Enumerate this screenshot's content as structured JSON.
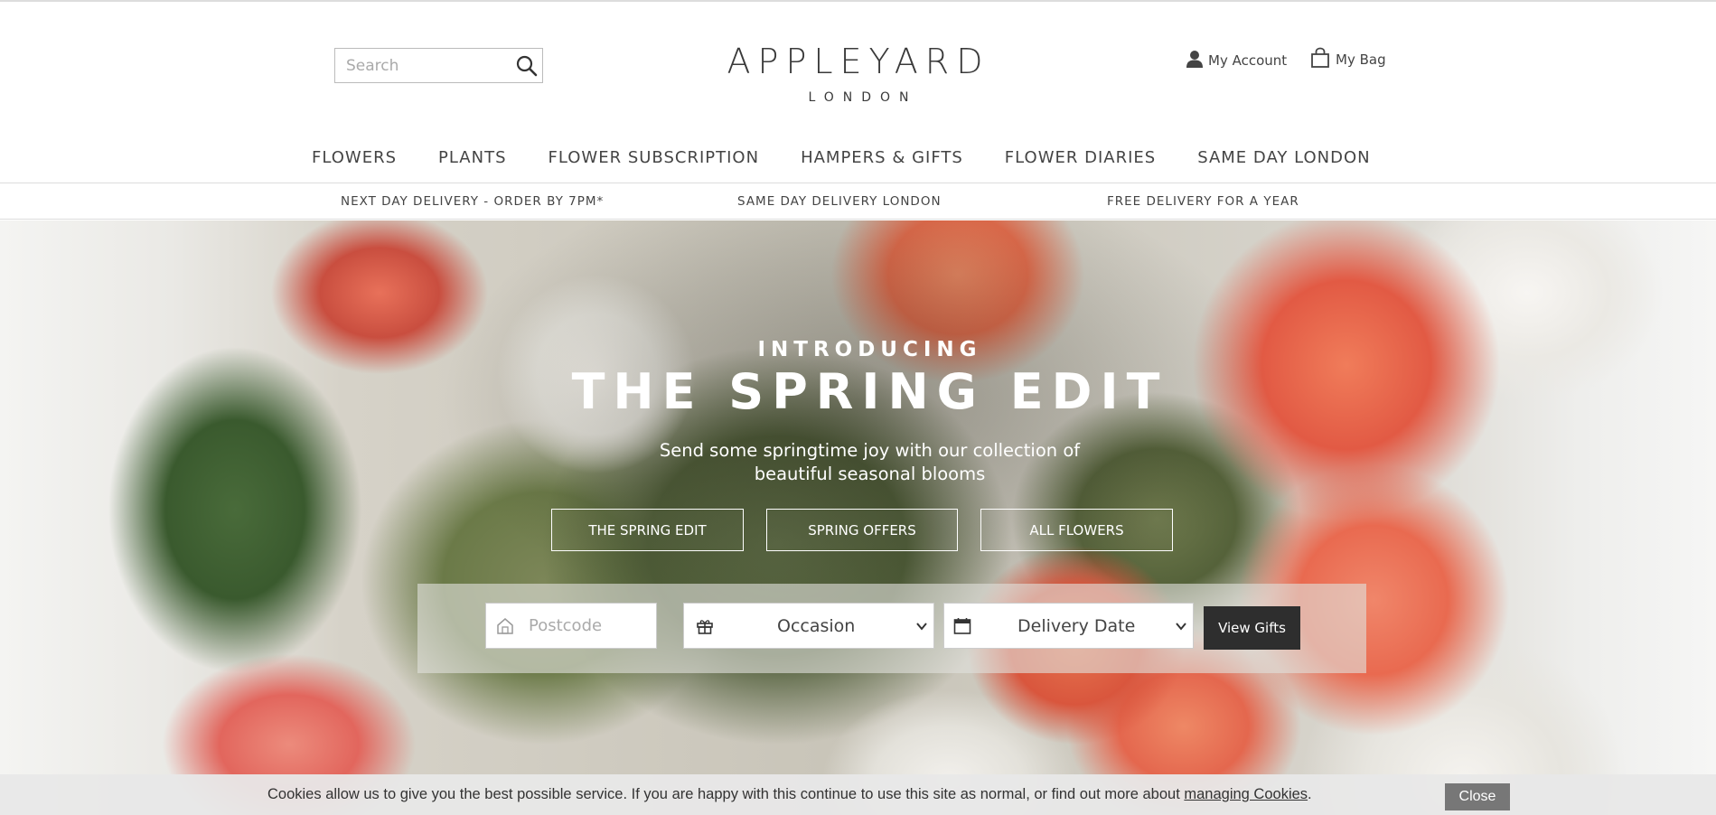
{
  "header": {
    "search_placeholder": "Search",
    "logo_main": "APPLEYARD",
    "logo_sub": "LONDON",
    "account_label": "My Account",
    "bag_label": "My Bag"
  },
  "nav": {
    "items": [
      {
        "label": "FLOWERS"
      },
      {
        "label": "PLANTS"
      },
      {
        "label": "FLOWER SUBSCRIPTION"
      },
      {
        "label": "HAMPERS & GIFTS"
      },
      {
        "label": "FLOWER DIARIES"
      },
      {
        "label": "SAME DAY LONDON"
      }
    ]
  },
  "delivery_strip": {
    "items": [
      {
        "label": "NEXT DAY DELIVERY - ORDER BY 7PM*"
      },
      {
        "label": "SAME DAY DELIVERY LONDON"
      },
      {
        "label": "FREE DELIVERY FOR A YEAR"
      }
    ]
  },
  "hero": {
    "kicker": "INTRODUCING",
    "headline": "THE SPRING EDIT",
    "subtext_line1": "Send some springtime joy with our collection of",
    "subtext_line2": "beautiful seasonal blooms",
    "buttons": [
      {
        "label": "THE SPRING EDIT"
      },
      {
        "label": "SPRING OFFERS"
      },
      {
        "label": "ALL FLOWERS"
      }
    ]
  },
  "gift_finder": {
    "postcode_placeholder": "Postcode",
    "occasion_value": "Occasion",
    "delivery_date_value": "Delivery Date",
    "submit_label": "View Gifts"
  },
  "cookie_banner": {
    "text": "Cookies allow us to give you the best possible service. If you are happy with this continue to use this site as normal, or find out more about ",
    "link_text": "managing Cookies",
    "trailing": ".",
    "close_label": "Close"
  },
  "colors": {
    "text_dark": "#444444",
    "button_dark": "#2e2e2e",
    "cookie_bg": "#e8e8e8",
    "cookie_close": "#777777"
  }
}
